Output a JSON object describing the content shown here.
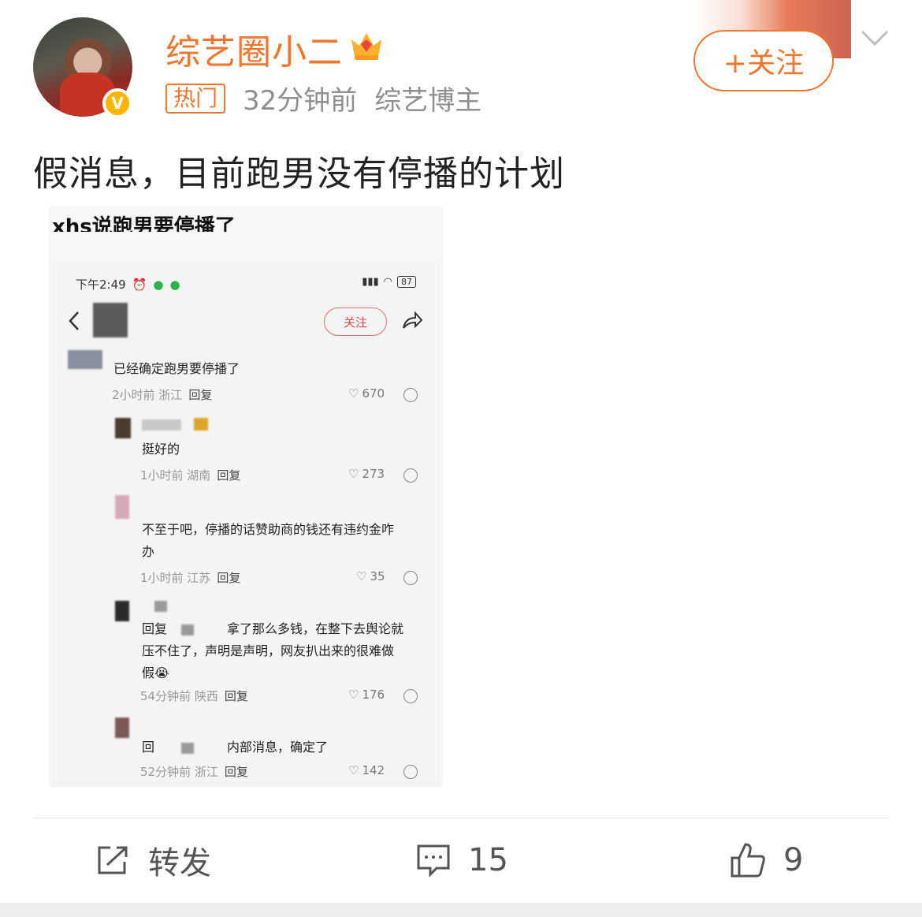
{
  "header": {
    "username": "综艺圈小二",
    "hot_tag": "热门",
    "time": "32分钟前",
    "role": "综艺博主",
    "verified_badge": "V",
    "follow_label": "+关注"
  },
  "post": {
    "text": "假消息，目前跑男没有停播的计划"
  },
  "image": {
    "caption": "xhs说跑男要停播了",
    "status_time": "下午2:49",
    "battery": "87",
    "follow_label": "关注",
    "comments": [
      {
        "text": "已经确定跑男要停播了",
        "meta": "2小时前 浙江",
        "reply": "回复",
        "likes": "670"
      },
      {
        "text": "挺好的",
        "meta": "1小时前 湖南",
        "reply": "回复",
        "likes": "273"
      },
      {
        "text": "不至于吧，停播的话赞助商的钱还有违约金咋",
        "text2": "办",
        "meta": "1小时前 江苏",
        "reply": "回复",
        "likes": "35"
      },
      {
        "prefix": "回复",
        "text": "拿了那么多钱，在整下去舆论就",
        "text2": "压不住了，声明是声明，网友扒出来的很难做",
        "text3": "假",
        "meta": "54分钟前 陕西",
        "reply": "回复",
        "likes": "176"
      },
      {
        "prefix": "回",
        "text": "内部消息，确定了",
        "meta": "52分钟前 浙江",
        "reply": "回复",
        "likes": "142"
      }
    ]
  },
  "footer": {
    "repost_label": "转发",
    "comment_count": "15",
    "like_count": "9"
  },
  "colors": {
    "accent": "#f0762d",
    "badge": "#ffb400"
  }
}
